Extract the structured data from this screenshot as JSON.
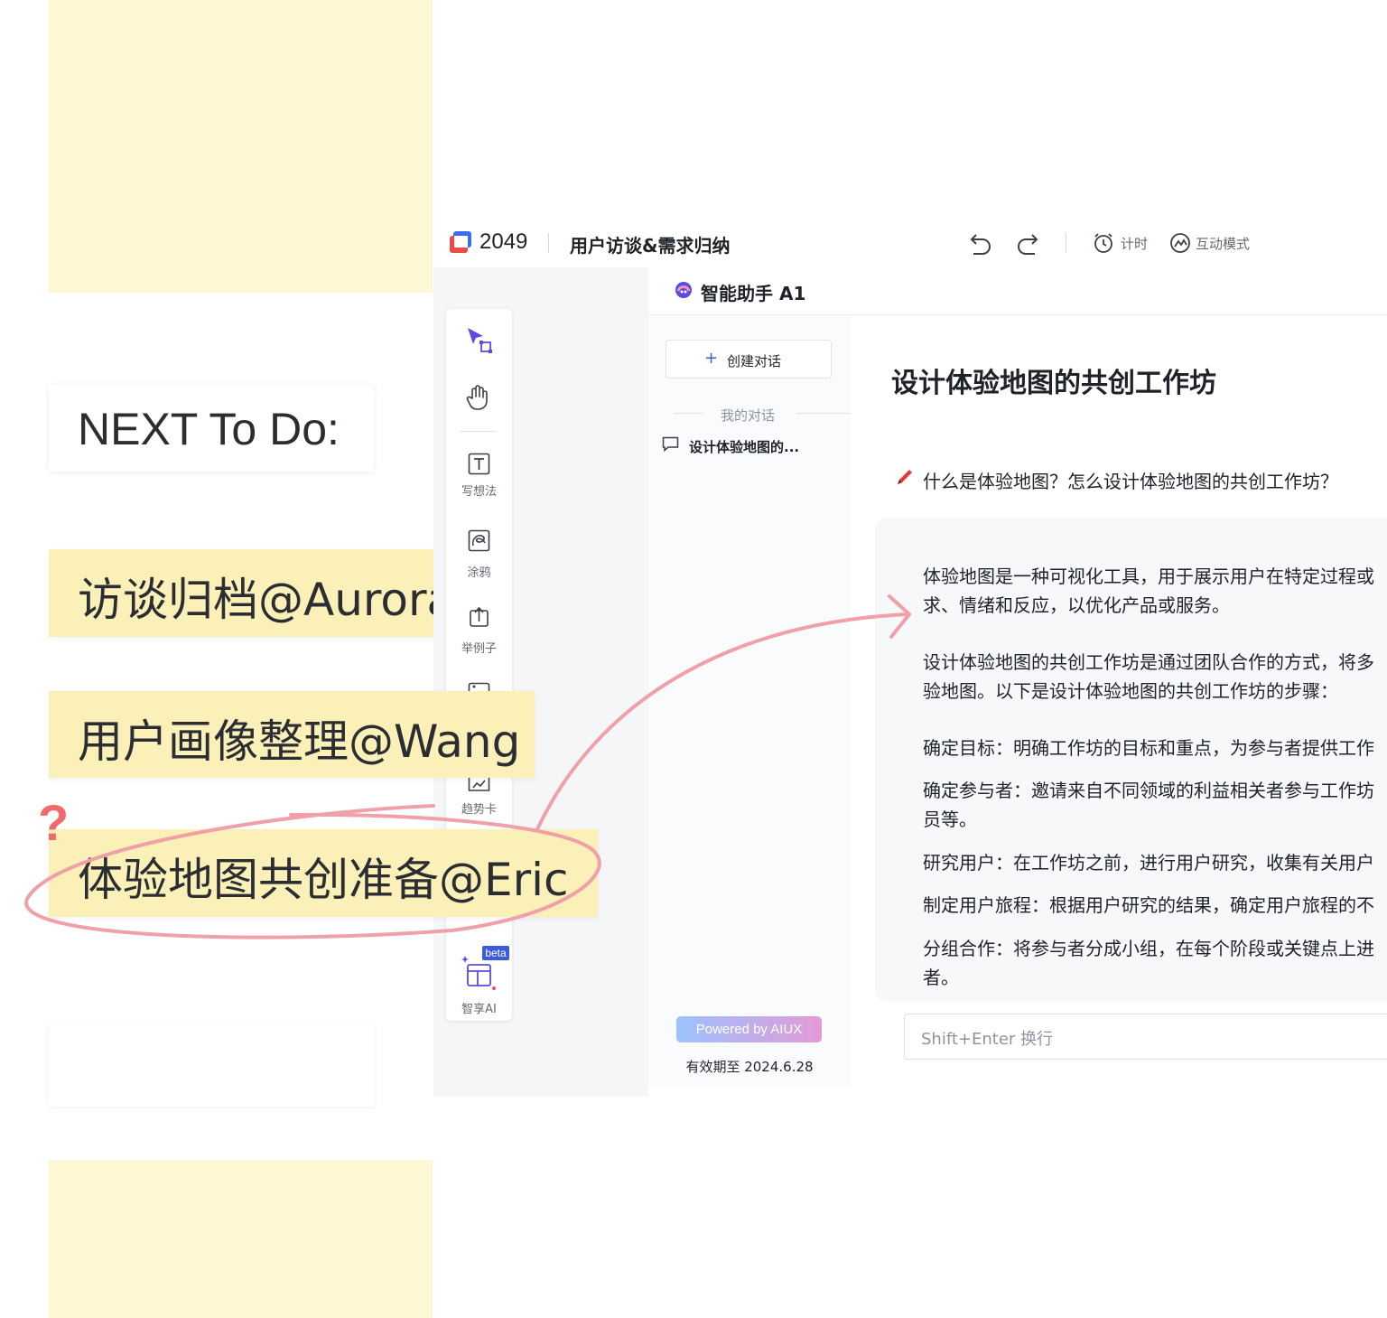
{
  "board": {
    "next_title": "NEXT To Do:",
    "tasks": [
      "访谈归档@Aurora",
      "用户画像整理@Wang",
      "体验地图共创准备@Eric"
    ],
    "question_mark": "?"
  },
  "topbar": {
    "app_number": "2049",
    "board_title": "用户访谈&需求归纳",
    "timer_label": "计时",
    "interactive_label": "互动模式"
  },
  "toolbar": {
    "tools": [
      {
        "label": "写想法",
        "icon": "text-icon"
      },
      {
        "label": "涂鸦",
        "icon": "doodle-icon"
      },
      {
        "label": "举例子",
        "icon": "upload-example-icon"
      },
      {
        "label": "趋势卡",
        "icon": "trend-card-icon"
      }
    ],
    "ai_tool": {
      "label": "智享AI",
      "badge": "beta",
      "icon": "layout-ai-icon"
    }
  },
  "assistant": {
    "title": "智能助手 A1",
    "new_chat_label": "创建对话",
    "my_conversations_label": "我的对话",
    "conversation_item": "设计体验地图的...",
    "powered_by": "Powered by AIUX",
    "valid_until": "有效期至 2024.6.28",
    "chat_title": "设计体验地图的共创工作坊",
    "question": "什么是体验地图？怎么设计体验地图的共创工作坊？",
    "answer_lines": [
      "体验地图是一种可视化工具，用于展示用户在特定过程或",
      "求、情绪和反应，以优化产品或服务。",
      "设计体验地图的共创工作坊是通过团队合作的方式，将多",
      "验地图。以下是设计体验地图的共创工作坊的步骤：",
      "确定目标：明确工作坊的目标和重点，为参与者提供工作",
      "确定参与者：邀请来自不同领域的利益相关者参与工作坊",
      "员等。",
      "研究用户：在工作坊之前，进行用户研究，收集有关用户",
      "制定用户旅程：根据用户研究的结果，确定用户旅程的不",
      "分组合作：将参与者分成小组，在每个阶段或关键点上进",
      "者。"
    ],
    "input_placeholder": "Shift+Enter 换行"
  },
  "colors": {
    "sticky": "#fdf8d3",
    "task_sticky": "#fbf1b8",
    "annotation_pink": "#f0a0a8",
    "question_red": "#f06a6a",
    "accent_blue": "#3b5bdb",
    "toolbar_purple": "#5b4be0"
  }
}
